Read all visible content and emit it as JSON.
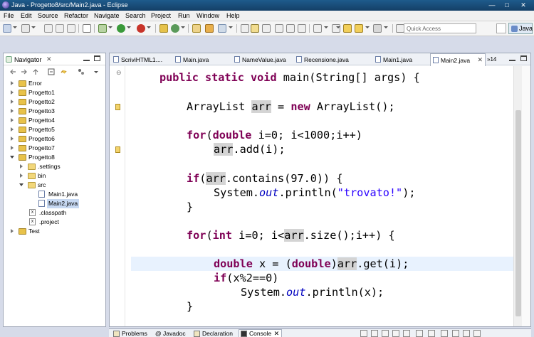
{
  "window": {
    "title": "Java - Progetto8/src/Main2.java - Eclipse",
    "minimize": "—",
    "maximize": "□",
    "close": "✕"
  },
  "menu": [
    "File",
    "Edit",
    "Source",
    "Refactor",
    "Navigate",
    "Search",
    "Project",
    "Run",
    "Window",
    "Help"
  ],
  "toolbar": {
    "quick_access_placeholder": "Quick Access",
    "perspective": "Java"
  },
  "navigator": {
    "title": "Navigator",
    "close": "✕",
    "tree": [
      {
        "label": "Error",
        "level": 0,
        "type": "project",
        "expanded": false
      },
      {
        "label": "Progetto1",
        "level": 0,
        "type": "project",
        "expanded": false
      },
      {
        "label": "Progetto2",
        "level": 0,
        "type": "project",
        "expanded": false
      },
      {
        "label": "Progetto3",
        "level": 0,
        "type": "project",
        "expanded": false
      },
      {
        "label": "Progetto4",
        "level": 0,
        "type": "project",
        "expanded": false
      },
      {
        "label": "Progetto5",
        "level": 0,
        "type": "project",
        "expanded": false
      },
      {
        "label": "Progetto6",
        "level": 0,
        "type": "project",
        "expanded": false
      },
      {
        "label": "Progetto7",
        "level": 0,
        "type": "project",
        "expanded": false
      },
      {
        "label": "Progetto8",
        "level": 0,
        "type": "project",
        "expanded": true
      },
      {
        "label": ".settings",
        "level": 1,
        "type": "folder",
        "expanded": false
      },
      {
        "label": "bin",
        "level": 1,
        "type": "folder",
        "expanded": false
      },
      {
        "label": "src",
        "level": 1,
        "type": "folder",
        "expanded": true
      },
      {
        "label": "Main1.java",
        "level": 2,
        "type": "java"
      },
      {
        "label": "Main2.java",
        "level": 2,
        "type": "java",
        "selected": true
      },
      {
        "label": ".classpath",
        "level": 1,
        "type": "xfile"
      },
      {
        "label": ".project",
        "level": 1,
        "type": "xfile"
      },
      {
        "label": "Test",
        "level": 0,
        "type": "project",
        "expanded": false
      }
    ]
  },
  "editor": {
    "tabs": [
      {
        "label": "ScriviHTML1....",
        "active": false
      },
      {
        "label": "Main.java",
        "active": false
      },
      {
        "label": "NameValue.java",
        "active": false
      },
      {
        "label": "Recensione.java",
        "active": false
      },
      {
        "label": "Main1.java",
        "active": false
      },
      {
        "label": "Main2.java",
        "active": true
      }
    ],
    "tab_close": "✕",
    "overflow": "»14",
    "code": {
      "l0": {
        "kw": "public static void",
        "rest": " main(String[] args) {"
      },
      "l1": {
        "a": "ArrayList ",
        "b": "arr",
        "c": " = ",
        "d": "new",
        "e": " ArrayList();"
      },
      "l2": {
        "a": "for",
        "b": "(",
        "c": "double",
        "d": " i=0; i<1000;i++)"
      },
      "l3": {
        "a": "arr",
        "b": ".add(i);"
      },
      "l4": {
        "a": "if",
        "b": "(",
        "c": "arr",
        "d": ".contains(97.0)) {"
      },
      "l5": {
        "a": "System.",
        "b": "out",
        "c": ".println(",
        "d": "\"trovato!\"",
        "e": ");"
      },
      "l6": "}",
      "l7": {
        "a": "for",
        "b": "(",
        "c": "int",
        "d": " i=0; i<",
        "e": "arr",
        "f": ".size();i++) {"
      },
      "l8": {
        "a": "double",
        "b": " x = (",
        "c": "double",
        "d": ")",
        "e": "arr",
        "f": ".get(i);"
      },
      "l9": {
        "a": "if",
        "b": "(x%2==0)"
      },
      "l10": {
        "a": "System.",
        "b": "out",
        "c": ".println(x);"
      },
      "l11": "}"
    }
  },
  "bottom_tabs": [
    {
      "label": "Problems",
      "active": false
    },
    {
      "label": "@ Javadoc",
      "active": false
    },
    {
      "label": "Declaration",
      "active": false
    },
    {
      "label": "Console",
      "active": true
    }
  ]
}
